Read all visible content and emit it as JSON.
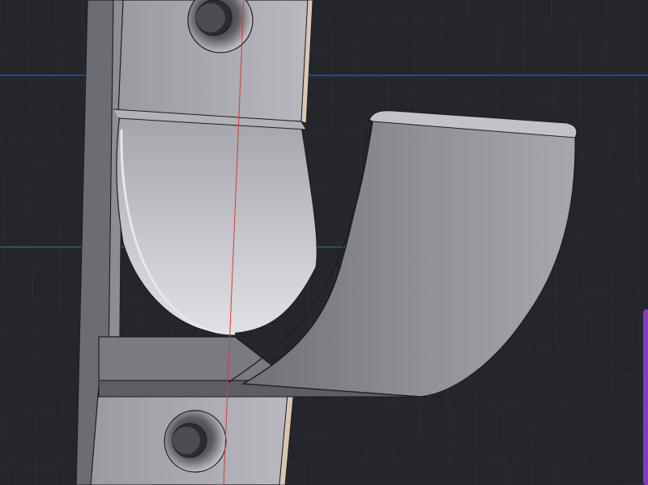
{
  "viewport": {
    "background": "#25252c",
    "grid_color": "#34343d",
    "axis_x_color": "#2f6fd0",
    "axis_y_color": "#2e8a4e",
    "axis_z_color": "#d83a3a",
    "model_color": "#9b9ba2",
    "side_panel_color": "#8e34c7"
  }
}
